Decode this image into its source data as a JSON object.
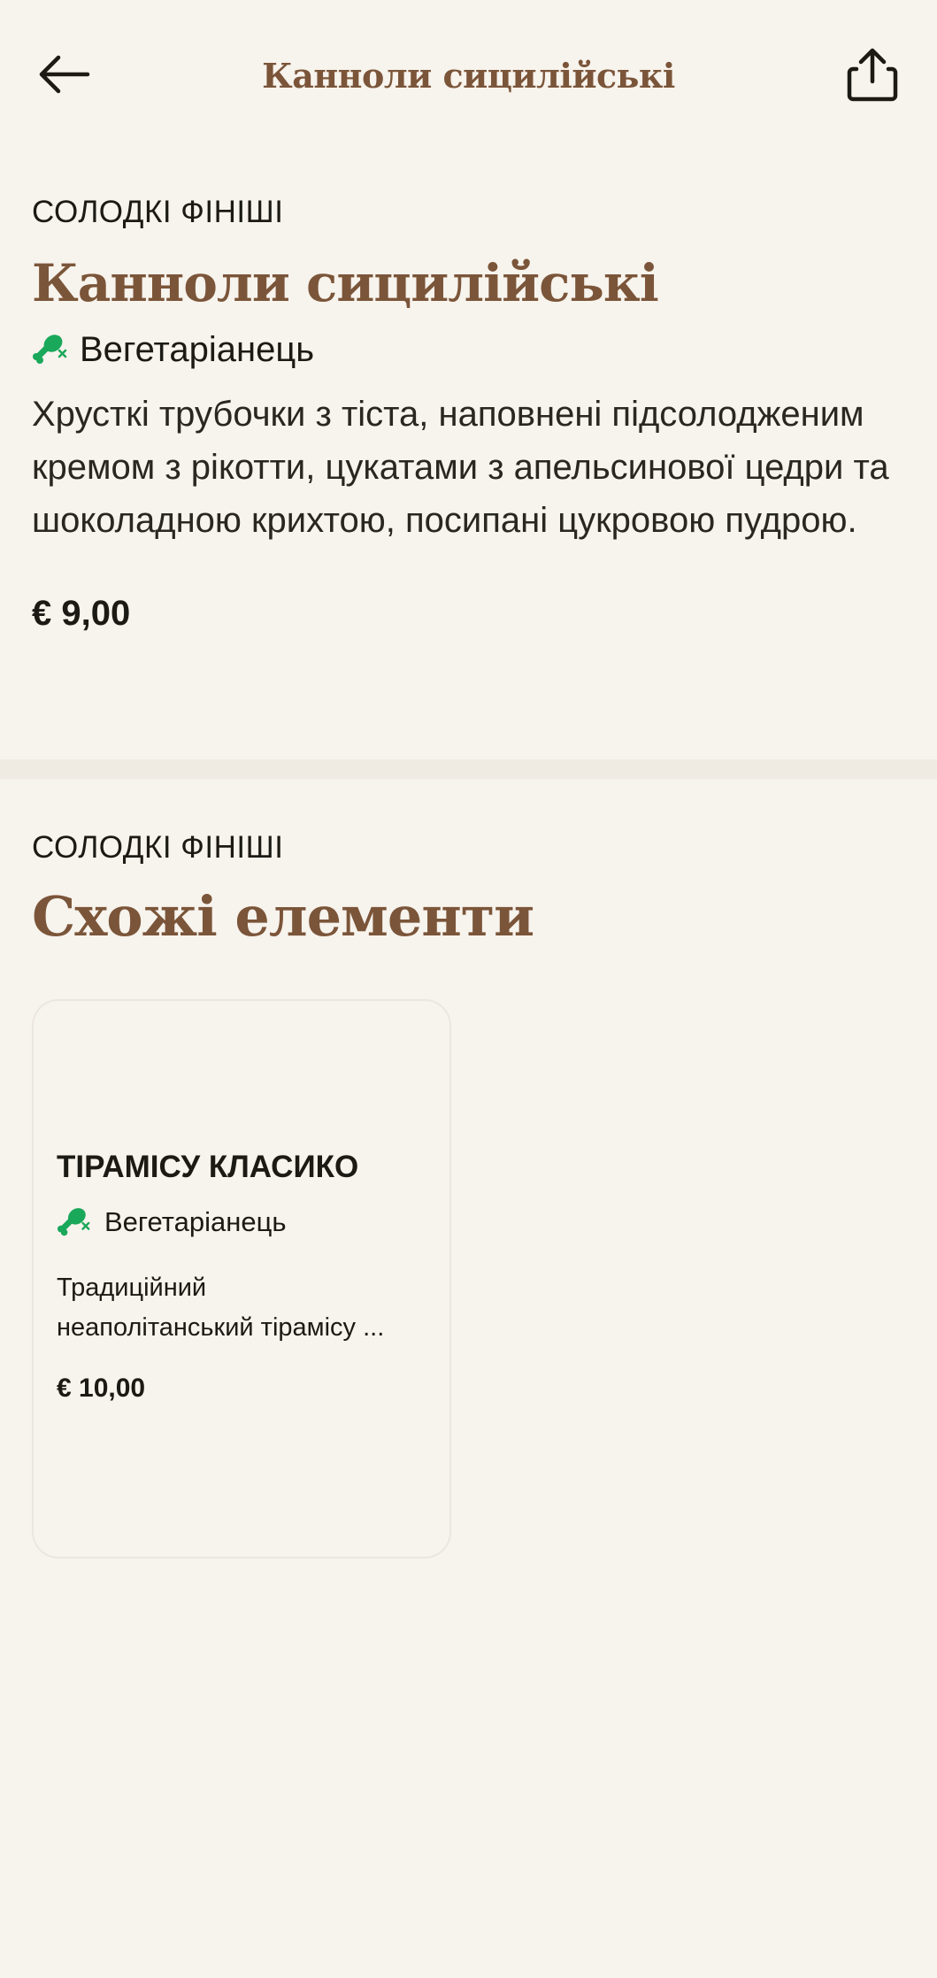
{
  "header": {
    "title": "Канноли сицилійські",
    "back_icon": "arrow-left-icon",
    "share_icon": "share-icon"
  },
  "item": {
    "category": "СОЛОДКІ ФІНІШІ",
    "name": "Канноли сицилійські",
    "diet_label": "Вегетаріанець",
    "diet_icon": "vegetarian-drumstick-icon",
    "description": "Хрусткі трубочки з тіста, наповнені підсолодженим кремом з рікотти, цукатами з апельсинової цедри та шоколадною крихтою, посипані цукровою пудрою.",
    "price": "€ 9,00"
  },
  "similar": {
    "category": "СОЛОДКІ ФІНІШІ",
    "heading": "Схожі елементи",
    "items": [
      {
        "name": "ТІРАМІСУ КЛАСИКО",
        "diet_label": "Вегетаріанець",
        "description_line1": "Традиційний",
        "description_line2": "неаполітанський тірамісу ...",
        "price": "€ 10,00"
      }
    ]
  },
  "colors": {
    "background": "#f7f3ed",
    "accent_brown": "#7b5539",
    "vegetarian_green": "#1aa85a",
    "divider": "#efebe3"
  }
}
